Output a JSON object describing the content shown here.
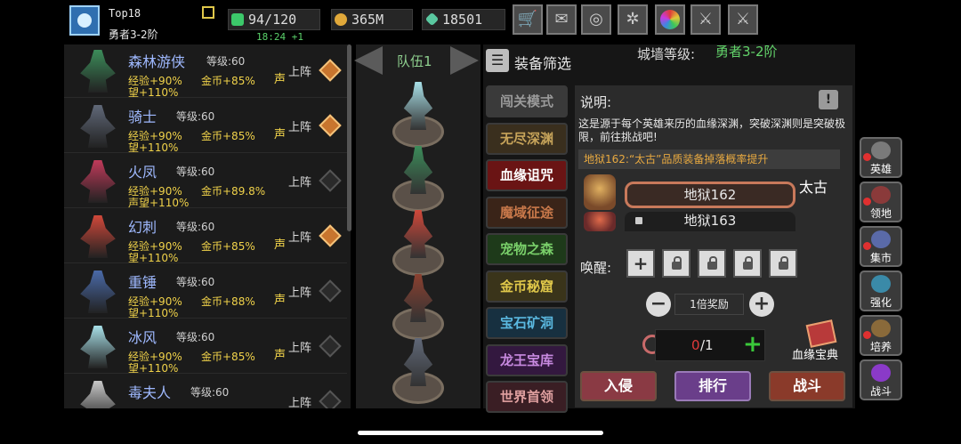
{
  "player": {
    "title": "Top18",
    "rank": "勇者3-2阶",
    "timer": "18:24 +1"
  },
  "resources": {
    "energy": "94/120",
    "gold": "365M",
    "gems": "18501"
  },
  "top_icons": [
    "cart-icon",
    "mail-icon",
    "gamepad-icon",
    "gear-icon",
    "color-wheel-icon",
    "feather-icon",
    "swords-icon"
  ],
  "heroes": [
    {
      "name": "森林游侠",
      "level": "等级:60",
      "exp": "经验+90%",
      "gold": "金币+85%",
      "fame_prefix": "声",
      "fame": "望+110%",
      "deploy": "上阵",
      "active": true,
      "color": "#3c8c5a"
    },
    {
      "name": "骑士",
      "level": "等级:60",
      "exp": "经验+90%",
      "gold": "金币+85%",
      "fame_prefix": "声",
      "fame": "望+110%",
      "deploy": "上阵",
      "active": true,
      "color": "#606878"
    },
    {
      "name": "火凤",
      "level": "等级:60",
      "exp": "经验+90%",
      "gold": "金币+89.8%",
      "fame_prefix": "",
      "fame": "声望+110%",
      "deploy": "上阵",
      "active": false,
      "color": "#c03a5a"
    },
    {
      "name": "幻刺",
      "level": "等级:60",
      "exp": "经验+90%",
      "gold": "金币+85%",
      "fame_prefix": "声",
      "fame": "望+110%",
      "deploy": "上阵",
      "active": true,
      "color": "#d0483a"
    },
    {
      "name": "重锤",
      "level": "等级:60",
      "exp": "经验+90%",
      "gold": "金币+88%",
      "fame_prefix": "声",
      "fame": "望+110%",
      "deploy": "上阵",
      "active": false,
      "color": "#4a6aa8"
    },
    {
      "name": "冰风",
      "level": "等级:60",
      "exp": "经验+90%",
      "gold": "金币+85%",
      "fame_prefix": "声",
      "fame": "望+110%",
      "deploy": "上阵",
      "active": false,
      "color": "#a8e0e8"
    },
    {
      "name": "毒夫人",
      "level": "等级:60",
      "exp": "",
      "gold": "",
      "fame_prefix": "",
      "fame": "",
      "deploy": "上阵",
      "active": false,
      "color": "#c8c8c8"
    }
  ],
  "team": {
    "title": "队伍1",
    "members": [
      "#a8e0e8",
      "#3c8c5a",
      "#d0483a",
      "#8a4030",
      "#606878"
    ]
  },
  "panel": {
    "filter_label": "装备筛选",
    "wall_label": "城墙等级:",
    "wall_value": "勇者3-2阶",
    "modes": [
      {
        "label": "闯关模式",
        "fg": "#9a9a9a",
        "bg": "#3a3a3a"
      },
      {
        "label": "无尽深渊",
        "fg": "#c7a45a",
        "bg": "#3a2f1e"
      },
      {
        "label": "血缘诅咒",
        "fg": "#ffffff",
        "bg": "#6a1414"
      },
      {
        "label": "魔域征途",
        "fg": "#c8784a",
        "bg": "#3a2418"
      },
      {
        "label": "宠物之森",
        "fg": "#7ad06a",
        "bg": "#1e3a1a"
      },
      {
        "label": "金币秘窟",
        "fg": "#e0c84a",
        "bg": "#3a341a"
      },
      {
        "label": "宝石矿洞",
        "fg": "#5ab8e0",
        "bg": "#173040"
      },
      {
        "label": "龙王宝库",
        "fg": "#c88ae0",
        "bg": "#33183f"
      },
      {
        "label": "世界首领",
        "fg": "#e0a0a0",
        "bg": "#3a1e24"
      }
    ],
    "desc_title": "说明:",
    "desc_text": "这是源于每个英雄来历的血缘深渊，突破深渊则是突破极限，前往挑战吧!",
    "notice": "地狱162:“太古”品质装备掉落概率提升",
    "hell_current": "地狱162",
    "hell_next": "地狱163",
    "quality": "太古",
    "awaken_label": "唤醒:",
    "reward": "1倍奖励",
    "ticket_used": "0",
    "ticket_total": "/1",
    "bloodline_book": "血缘宝典",
    "buttons": {
      "invade": "入侵",
      "rank": "排行",
      "fight": "战斗"
    }
  },
  "side_menu": [
    {
      "label": "英雄",
      "alert": true
    },
    {
      "label": "领地",
      "alert": true
    },
    {
      "label": "集市",
      "alert": true
    },
    {
      "label": "强化",
      "alert": false
    },
    {
      "label": "培养",
      "alert": true
    },
    {
      "label": "战斗",
      "alert": false
    }
  ]
}
